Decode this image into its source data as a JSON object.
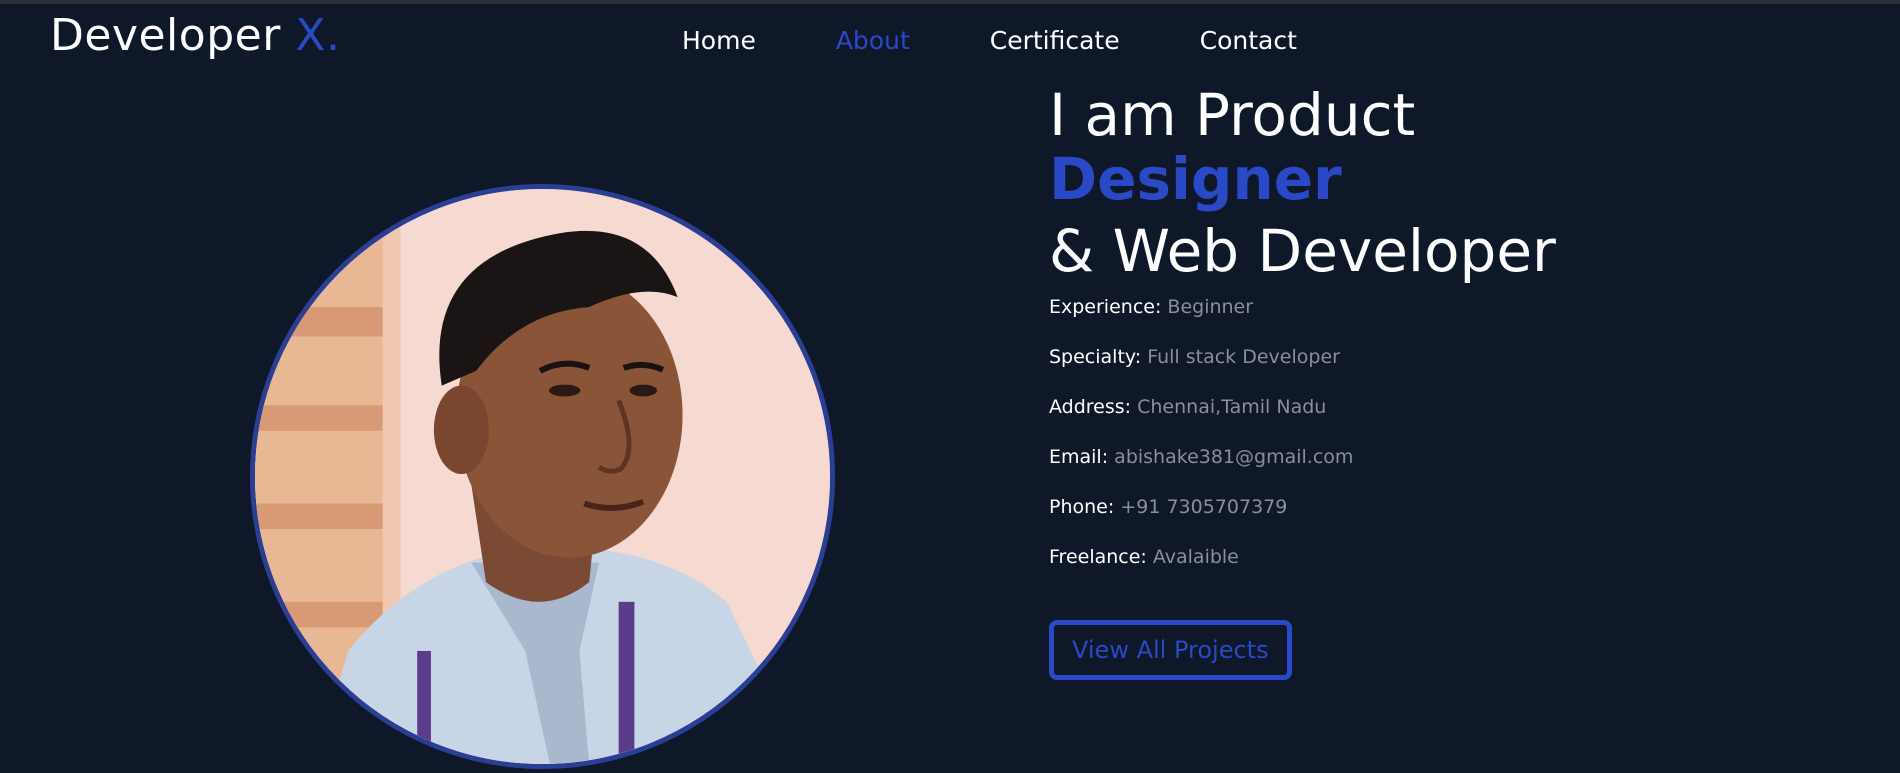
{
  "header": {
    "logo_text": "Developer",
    "logo_accent": "X.",
    "nav": [
      {
        "label": "Home"
      },
      {
        "label": "About"
      },
      {
        "label": "Certificate"
      },
      {
        "label": "Contact"
      }
    ],
    "active_nav": "About"
  },
  "hero": {
    "line1": "I am Product",
    "line2": "Designer",
    "line3": "& Web Developer",
    "details": [
      {
        "key": "Experience:",
        "value": "Beginner"
      },
      {
        "key": "Specialty:",
        "value": "Full stack Developer"
      },
      {
        "key": "Address:",
        "value": "Chennai,Tamil Nadu"
      },
      {
        "key": "Email:",
        "value": "abishake381@gmail.com"
      },
      {
        "key": "Phone:",
        "value": "+91 7305707379"
      },
      {
        "key": "Freelance:",
        "value": "Avalaible"
      }
    ],
    "cta_label": "View All Projects"
  },
  "colors": {
    "background": "#0f1829",
    "accent": "#2a49c6",
    "muted_text": "#8a8f9a"
  }
}
